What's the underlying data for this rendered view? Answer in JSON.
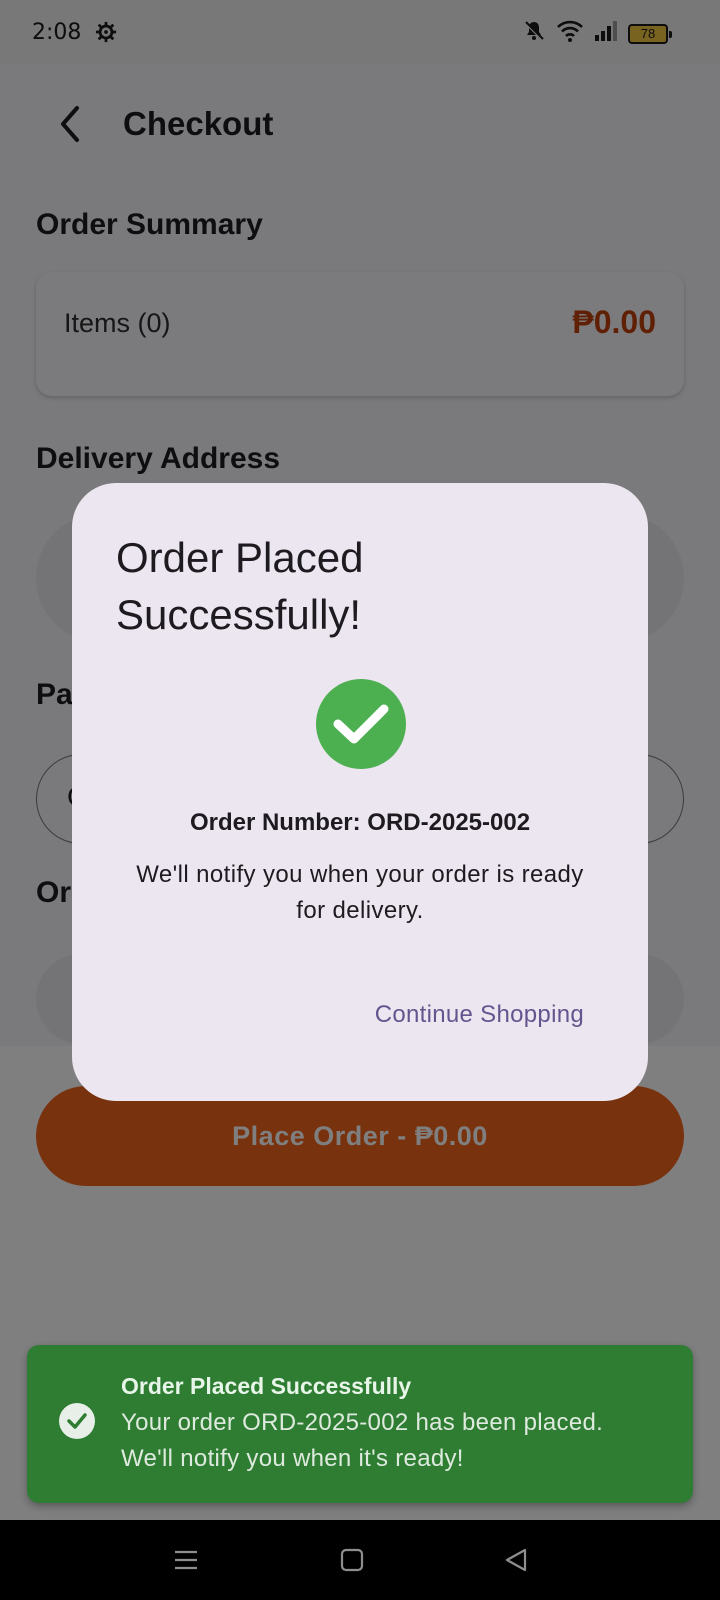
{
  "status_bar": {
    "time": "2:08",
    "battery_level": "78",
    "icons": [
      "settings-gear-icon",
      "bell-muted-icon",
      "wifi-icon",
      "cellular-signal-icon",
      "battery-icon"
    ]
  },
  "header": {
    "title": "Checkout",
    "back_icon": "chevron-left-icon"
  },
  "order_summary": {
    "section_title": "Order Summary",
    "items_label": "Items (0)",
    "items_total": "₱0.00"
  },
  "delivery": {
    "section_title": "Delivery Address"
  },
  "payment": {
    "section_title_visible": "Pa",
    "field_visible_text": "C"
  },
  "notes": {
    "section_title_visible": "Or"
  },
  "place_order": {
    "label": "Place Order - ₱0.00"
  },
  "dialog": {
    "title": "Order Placed Successfully!",
    "icon": "check-circle-icon",
    "order_number": "Order Number: ORD-2025-002",
    "message": "We'll notify you when your order is ready for delivery.",
    "action_label": "Continue Shopping"
  },
  "toast": {
    "icon": "check-circle-icon",
    "title": "Order Placed Successfully",
    "body": "Your order ORD-2025-002 has been placed. We'll notify you when it's ready!"
  },
  "nav_bar": {
    "icons": [
      "menu-icon",
      "home-square-icon",
      "back-triangle-icon"
    ]
  },
  "colors": {
    "accent": "#f2651c",
    "price": "#c0410b",
    "success": "#4caf50",
    "toast_bg": "#2e7d32",
    "dialog_bg": "#ece6f0",
    "dialog_action": "#65558f"
  }
}
